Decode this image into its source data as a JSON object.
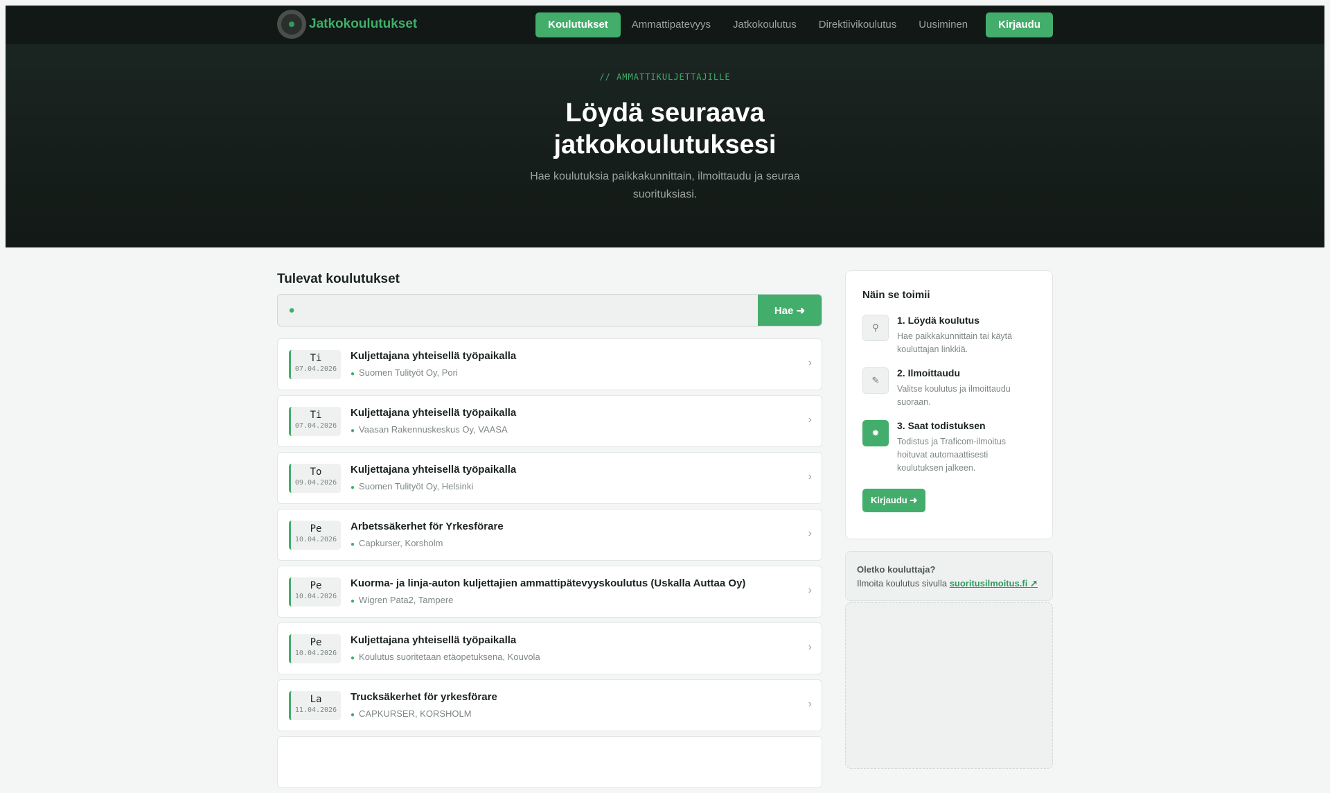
{
  "nav": {
    "brand": "Jatkokoulutukset",
    "links": [
      "Koulutukset",
      "Ammattipatevyys",
      "Jatkokoulutus",
      "Direktiivikoulutus",
      "Uusiminen"
    ],
    "login": "Kirjaudu"
  },
  "hero": {
    "eyebrow": "// AMMATTIKULJETTAJILLE",
    "title_line1": "Löydä seuraava",
    "title_line2": "jatkokoulutuksesi",
    "subtitle": "Hae koulutuksia paikkakunnittain, ilmoittaudu ja seuraa suorituksiasi."
  },
  "main": {
    "heading": "Tulevat koulutukset",
    "search_placeholder": "",
    "search_button": "Hae",
    "courses": [
      {
        "day": "Ti",
        "date": "07.04.2026",
        "title": "Kuljettajana yhteisellä työpaikalla",
        "location": "Suomen Tulityöt Oy, Pori"
      },
      {
        "day": "Ti",
        "date": "07.04.2026",
        "title": "Kuljettajana yhteisellä työpaikalla",
        "location": "Vaasan Rakennuskeskus Oy, VAASA"
      },
      {
        "day": "To",
        "date": "09.04.2026",
        "title": "Kuljettajana yhteisellä työpaikalla",
        "location": "Suomen Tulityöt Oy, Helsinki"
      },
      {
        "day": "Pe",
        "date": "10.04.2026",
        "title": "Arbetssäkerhet för Yrkesförare",
        "location": "Capkurser, Korsholm"
      },
      {
        "day": "Pe",
        "date": "10.04.2026",
        "title": "Kuorma- ja linja-auton kuljettajien ammattipätevyyskoulutus (Uskalla Auttaa Oy)",
        "location": "Wigren Pata2, Tampere"
      },
      {
        "day": "Pe",
        "date": "10.04.2026",
        "title": "Kuljettajana yhteisellä työpaikalla",
        "location": "Koulutus suoritetaan etäopetuksena, Kouvola"
      },
      {
        "day": "La",
        "date": "11.04.2026",
        "title": "Trucksäkerhet för yrkesförare",
        "location": "CAPKURSER, KORSHOLM"
      }
    ]
  },
  "side": {
    "heading": "Näin se toimii",
    "steps": [
      {
        "title": "1. Löydä koulutus",
        "text": "Hae paikkakunnittain tai käytä kouluttajan linkkiä.",
        "icon": "search-icon"
      },
      {
        "title": "2. Ilmoittaudu",
        "text": "Valitse koulutus ja ilmoittaudu suoraan.",
        "icon": "edit-icon"
      },
      {
        "title": "3. Saat todistuksen",
        "text": "Todistus ja Traficom-ilmoitus hoituvat automaattisesti koulutuksen jalkeen.",
        "icon": "certificate-icon"
      }
    ],
    "button": "Kirjaudu",
    "trainer_q": "Oletko kouluttaja?",
    "trainer_text": "Ilmoita koulutus sivulla",
    "trainer_link": "suoritusilmoitus.fi"
  }
}
